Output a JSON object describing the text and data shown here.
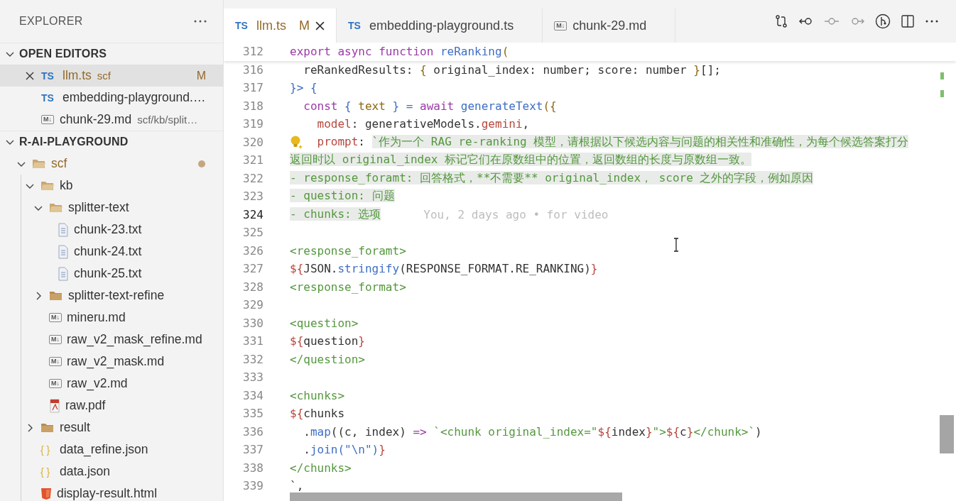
{
  "sidebar": {
    "title": "EXPLORER",
    "open_editors": {
      "title": "OPEN EDITORS",
      "expanded": true,
      "items": [
        {
          "kind": "ts",
          "icon_label": "TS",
          "name": "llm.ts",
          "description": "scf",
          "badge": "M",
          "modified": true,
          "selected": true
        },
        {
          "kind": "ts",
          "icon_label": "TS",
          "name": "embedding-playground.…",
          "modified": false,
          "selected": false
        },
        {
          "kind": "md",
          "icon_label": "M↓",
          "name": "chunk-29.md",
          "description": "scf/kb/split…",
          "modified": false,
          "selected": false
        }
      ]
    },
    "workspace": {
      "title": "R-AI-PLAYGROUND",
      "expanded": true,
      "tree": [
        {
          "kind": "folder",
          "name": "scf",
          "expanded": true,
          "modified": true,
          "children": [
            {
              "kind": "folder",
              "name": "kb",
              "expanded": true,
              "modified": false,
              "children": [
                {
                  "kind": "folder",
                  "name": "splitter-text",
                  "expanded": true,
                  "modified": false,
                  "children": [
                    {
                      "kind": "txt",
                      "name": "chunk-23.txt",
                      "modified": false
                    },
                    {
                      "kind": "txt",
                      "name": "chunk-24.txt",
                      "modified": false
                    },
                    {
                      "kind": "txt",
                      "name": "chunk-25.txt",
                      "modified": false
                    }
                  ]
                },
                {
                  "kind": "folder",
                  "name": "splitter-text-refine",
                  "expanded": false,
                  "modified": false
                },
                {
                  "kind": "md",
                  "icon_label": "M↓",
                  "name": "mineru.md",
                  "modified": false
                },
                {
                  "kind": "md",
                  "icon_label": "M↓",
                  "name": "raw_v2_mask_refine.md",
                  "modified": false
                },
                {
                  "kind": "md",
                  "icon_label": "M↓",
                  "name": "raw_v2_mask.md",
                  "modified": false
                },
                {
                  "kind": "md",
                  "icon_label": "M↓",
                  "name": "raw_v2.md",
                  "modified": false
                },
                {
                  "kind": "pdf",
                  "name": "raw.pdf",
                  "modified": false
                }
              ]
            },
            {
              "kind": "folder",
              "name": "result",
              "expanded": false,
              "modified": false
            },
            {
              "kind": "json",
              "icon_label": "{ }",
              "name": "data_refine.json",
              "modified": false
            },
            {
              "kind": "json",
              "icon_label": "{ }",
              "name": "data.json",
              "modified": false
            },
            {
              "kind": "html",
              "name": "display-result.html",
              "modified": false
            }
          ]
        }
      ]
    }
  },
  "tabs": [
    {
      "kind": "ts",
      "icon_label": "TS",
      "label": "llm.ts",
      "badge": "M",
      "modified": true,
      "selected": true
    },
    {
      "kind": "ts",
      "icon_label": "TS",
      "label": "embedding-playground.ts",
      "modified": false,
      "selected": false
    },
    {
      "kind": "md",
      "icon_label": "M↓",
      "label": "chunk-29.md",
      "modified": false,
      "selected": false
    }
  ],
  "editor": {
    "sticky_line": {
      "number": "312",
      "tokens": [
        {
          "text": "export async function ",
          "kind": "kw"
        },
        {
          "text": "reRanking",
          "kind": "fn"
        },
        {
          "text": "(",
          "kind": "var"
        }
      ]
    },
    "lines": [
      {
        "number": "316",
        "active": false,
        "tokens": [
          {
            "text": "  reRankedResults: ",
            "kind": "plain"
          },
          {
            "text": "{",
            "kind": "var"
          },
          {
            "text": " original_index: number; score: number ",
            "kind": "plain"
          },
          {
            "text": "}",
            "kind": "var"
          },
          {
            "text": "[];",
            "kind": "plain"
          }
        ]
      },
      {
        "number": "317",
        "active": false,
        "tokens": [
          {
            "text": "}>",
            "kind": "tag"
          },
          {
            "text": " {",
            "kind": "fn"
          }
        ]
      },
      {
        "number": "318",
        "active": false,
        "tokens": [
          {
            "text": "  const",
            "kind": "kw"
          },
          {
            "text": " { ",
            "kind": "tag"
          },
          {
            "text": "text",
            "kind": "var"
          },
          {
            "text": " } = ",
            "kind": "tag"
          },
          {
            "text": "await ",
            "kind": "kw"
          },
          {
            "text": "generateText",
            "kind": "fn"
          },
          {
            "text": "({",
            "kind": "var"
          }
        ]
      },
      {
        "number": "319",
        "active": false,
        "tokens": [
          {
            "text": "    model",
            "kind": "prop"
          },
          {
            "text": ": generativeModels.",
            "kind": "plain"
          },
          {
            "text": "gemini",
            "kind": "prop"
          },
          {
            "text": ",",
            "kind": "plain"
          }
        ]
      },
      {
        "number": "320",
        "active": false,
        "lightbulb": true,
        "tokens": [
          {
            "text": "    prompt",
            "kind": "prop"
          },
          {
            "text": ": ",
            "kind": "plain"
          },
          {
            "text": "`作为一个 RAG re-ranking 模型，请根据以下候选内容与问题的相关性和准确性，为每个候选答案打分",
            "kind": "str",
            "selected": true
          }
        ]
      },
      {
        "number": "321",
        "active": false,
        "tokens": [
          {
            "text": "返回时以 original_index 标记它们在原数组中的位置，返回数组的长度与原数组一致。",
            "kind": "str",
            "selected": true
          }
        ]
      },
      {
        "number": "322",
        "active": false,
        "tokens": [
          {
            "text": "- response_foramt: 回答格式，**不需要** original_index， score 之外的字段，例如原因",
            "kind": "str",
            "selected": true
          }
        ]
      },
      {
        "number": "323",
        "active": false,
        "tokens": [
          {
            "text": "- question: 问题",
            "kind": "str",
            "selected": true
          }
        ]
      },
      {
        "number": "324",
        "active": true,
        "blame": "You, 2 days ago • for video",
        "tokens": [
          {
            "text": "- chunks: 选项",
            "kind": "str",
            "selected": true
          }
        ]
      },
      {
        "number": "325",
        "active": false
      },
      {
        "number": "326",
        "active": false,
        "tokens": [
          {
            "text": "<response_foramt>",
            "kind": "str"
          }
        ]
      },
      {
        "number": "327",
        "active": false,
        "tokens": [
          {
            "text": "${",
            "kind": "prop"
          },
          {
            "text": "JSON.",
            "kind": "plain"
          },
          {
            "text": "stringify",
            "kind": "fn"
          },
          {
            "text": "(RESPONSE_FORMAT.RE_RANKING)",
            "kind": "plain"
          },
          {
            "text": "}",
            "kind": "prop"
          }
        ]
      },
      {
        "number": "328",
        "active": false,
        "tokens": [
          {
            "text": "<response_format>",
            "kind": "str"
          }
        ]
      },
      {
        "number": "329",
        "active": false
      },
      {
        "number": "330",
        "active": false,
        "tokens": [
          {
            "text": "<question>",
            "kind": "str"
          }
        ]
      },
      {
        "number": "331",
        "active": false,
        "tokens": [
          {
            "text": "${",
            "kind": "prop"
          },
          {
            "text": "question",
            "kind": "plain"
          },
          {
            "text": "}",
            "kind": "prop"
          }
        ]
      },
      {
        "number": "332",
        "active": false,
        "tokens": [
          {
            "text": "</question>",
            "kind": "str"
          }
        ]
      },
      {
        "number": "333",
        "active": false
      },
      {
        "number": "334",
        "active": false,
        "tokens": [
          {
            "text": "<chunks>",
            "kind": "str"
          }
        ]
      },
      {
        "number": "335",
        "active": false,
        "tokens": [
          {
            "text": "${",
            "kind": "prop"
          },
          {
            "text": "chunks",
            "kind": "plain"
          }
        ]
      },
      {
        "number": "336",
        "active": false,
        "tokens": [
          {
            "text": "  .",
            "kind": "plain"
          },
          {
            "text": "map",
            "kind": "fn"
          },
          {
            "text": "((c, index) ",
            "kind": "plain"
          },
          {
            "text": "=>",
            "kind": "kw"
          },
          {
            "text": " `<chunk original_index=\"",
            "kind": "str"
          },
          {
            "text": "${",
            "kind": "prop"
          },
          {
            "text": "index",
            "kind": "plain"
          },
          {
            "text": "}",
            "kind": "prop"
          },
          {
            "text": "\">",
            "kind": "str"
          },
          {
            "text": "${",
            "kind": "prop"
          },
          {
            "text": "c",
            "kind": "plain"
          },
          {
            "text": "}",
            "kind": "prop"
          },
          {
            "text": "</chunk>`",
            "kind": "str"
          },
          {
            "text": ")",
            "kind": "plain"
          }
        ]
      },
      {
        "number": "337",
        "active": false,
        "tokens": [
          {
            "text": "  .",
            "kind": "plain"
          },
          {
            "text": "join",
            "kind": "fn"
          },
          {
            "text": "(\"\\n\")",
            "kind": "fn"
          },
          {
            "text": "}",
            "kind": "prop"
          }
        ]
      },
      {
        "number": "338",
        "active": false,
        "tokens": [
          {
            "text": "</chunks>",
            "kind": "str"
          }
        ]
      },
      {
        "number": "339",
        "active": false,
        "tokens": [
          {
            "text": "`,",
            "kind": "plain"
          }
        ]
      }
    ]
  }
}
